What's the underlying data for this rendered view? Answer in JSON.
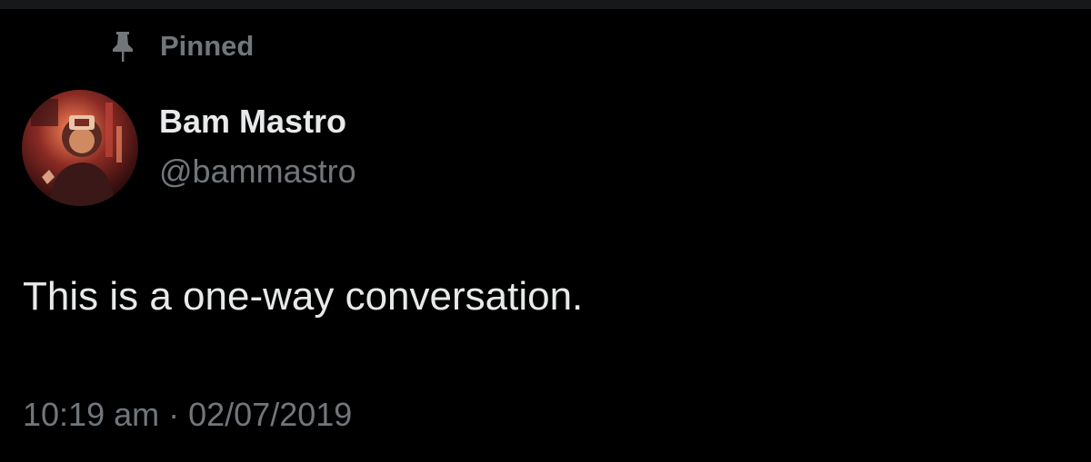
{
  "pinned": {
    "icon": "pin-icon",
    "label": "Pinned"
  },
  "author": {
    "display_name": "Bam Mastro",
    "handle": "@bammastro",
    "avatar": "avatar"
  },
  "tweet": {
    "text": "This is a one-way conversation.",
    "time": "10:19 am",
    "separator": "·",
    "date": "02/07/2019"
  },
  "colors": {
    "background": "#000000",
    "text_primary": "#e7e9ea",
    "text_secondary": "#71767b"
  }
}
